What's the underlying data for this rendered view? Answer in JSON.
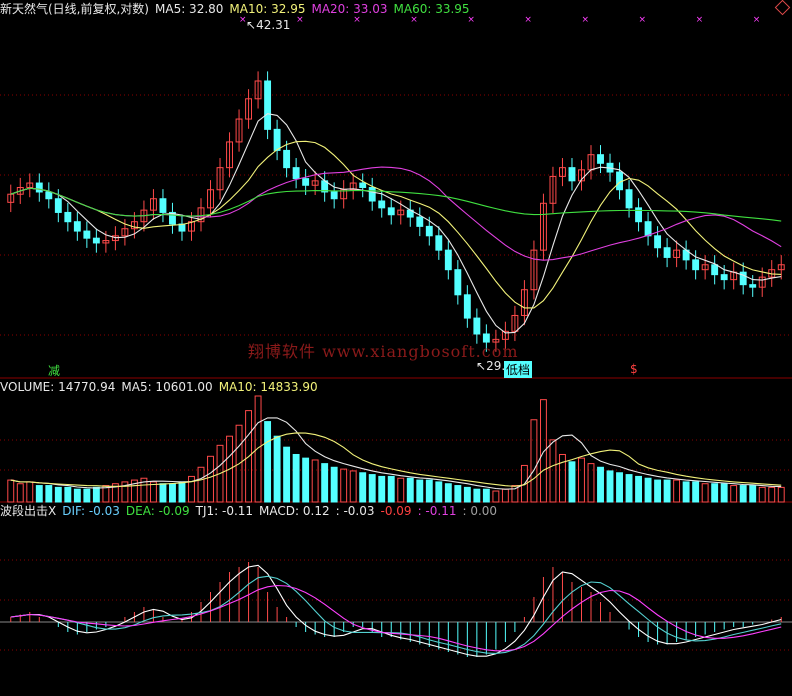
{
  "header": {
    "price": [
      {
        "text": "新天然气(日线,前复权,对数)",
        "color": "#e8e8e8"
      },
      {
        "text": "MA5: 32.80",
        "color": "#e8e8e8"
      },
      {
        "text": "MA10: 32.95",
        "color": "#f2f27a"
      },
      {
        "text": "MA20: 33.03",
        "color": "#e040e0"
      },
      {
        "text": "MA60: 33.95",
        "color": "#40e040"
      }
    ],
    "volume": [
      {
        "text": "VOLUME: 14770.94",
        "color": "#e8e8e8"
      },
      {
        "text": "MA5: 10601.00",
        "color": "#e8e8e8"
      },
      {
        "text": "MA10: 14833.90",
        "color": "#f2f27a"
      }
    ],
    "macd": [
      {
        "text": "波段出击X",
        "color": "#e8e8e8"
      },
      {
        "text": "DIF: -0.03",
        "color": "#6ad0ff"
      },
      {
        "text": "DEA: -0.09",
        "color": "#40e040"
      },
      {
        "text": "TJ1: -0.11",
        "color": "#e8e8e8"
      },
      {
        "text": "MACD: 0.12",
        "color": "#e8e8e8"
      },
      {
        "text": ": -0.03",
        "color": "#e8e8e8"
      },
      {
        "text": "-0.09",
        "color": "#ff4040"
      },
      {
        "text": ": -0.11",
        "color": "#e040e0"
      },
      {
        "text": ": 0.00",
        "color": "#a0a0a0"
      }
    ]
  },
  "annotations": {
    "high_label": "42.31",
    "low_label": "29.63",
    "jian_label": "减",
    "di_label": "低档",
    "dollar_label": "$",
    "watermark": "翔博软件 www.xiangbosoft.com"
  },
  "colors": {
    "up": "#ff4a4a",
    "down": "#54ffff",
    "ma5": "#e8e8e8",
    "ma10": "#f2f27a",
    "ma20": "#e040e0",
    "ma60": "#40e040",
    "grid": "#8b0000",
    "x_marker": "#ff40ff"
  },
  "icons": {
    "corner": "diamond-icon"
  },
  "chart_data": {
    "type": "candlestick",
    "scale": "log",
    "ylim": [
      29,
      44
    ],
    "high": 42.31,
    "low": 29.63,
    "closes": [
      35.8,
      36.1,
      36.3,
      35.9,
      35.6,
      35.0,
      34.6,
      34.2,
      33.9,
      33.7,
      33.8,
      34.0,
      34.3,
      34.6,
      35.1,
      35.6,
      35.0,
      34.5,
      34.2,
      34.6,
      35.2,
      36.0,
      37.0,
      38.2,
      39.3,
      40.3,
      41.2,
      38.8,
      37.8,
      37.0,
      36.5,
      36.2,
      36.4,
      35.9,
      35.6,
      36.0,
      36.3,
      36.1,
      35.5,
      35.2,
      34.9,
      35.1,
      34.8,
      34.4,
      34.0,
      33.4,
      32.6,
      31.6,
      30.7,
      30.1,
      29.8,
      29.9,
      30.2,
      30.8,
      31.8,
      33.4,
      35.4,
      36.6,
      37.0,
      36.4,
      36.9,
      37.6,
      37.2,
      36.8,
      36.0,
      35.2,
      34.6,
      34.0,
      33.5,
      33.1,
      33.4,
      33.0,
      32.6,
      32.8,
      32.4,
      32.2,
      32.5,
      32.0,
      31.9,
      32.3,
      32.6,
      32.8
    ],
    "volumes": [
      1.2,
      1.0,
      1.1,
      0.9,
      0.9,
      0.8,
      0.8,
      0.7,
      0.7,
      0.8,
      0.9,
      1.0,
      1.1,
      1.2,
      1.3,
      1.1,
      1.0,
      1.0,
      1.1,
      1.4,
      1.9,
      2.5,
      3.1,
      3.6,
      4.2,
      5.0,
      5.8,
      4.4,
      3.6,
      3.0,
      2.6,
      2.4,
      2.3,
      2.1,
      1.9,
      1.8,
      1.7,
      1.6,
      1.5,
      1.4,
      1.4,
      1.3,
      1.3,
      1.2,
      1.2,
      1.1,
      1.0,
      0.9,
      0.8,
      0.7,
      0.7,
      0.6,
      0.7,
      0.9,
      2.0,
      4.5,
      5.6,
      3.4,
      2.6,
      2.2,
      2.4,
      2.1,
      1.9,
      1.7,
      1.6,
      1.5,
      1.4,
      1.3,
      1.2,
      1.2,
      1.2,
      1.1,
      1.1,
      1.0,
      1.0,
      1.0,
      0.9,
      0.9,
      0.9,
      0.8,
      0.8,
      0.8
    ],
    "macd_hist": [
      0.1,
      0.15,
      0.2,
      0.1,
      0.0,
      -0.1,
      -0.2,
      -0.25,
      -0.2,
      -0.15,
      -0.1,
      0.0,
      0.1,
      0.2,
      0.3,
      0.25,
      0.1,
      0.0,
      0.05,
      0.2,
      0.4,
      0.6,
      0.8,
      1.0,
      1.1,
      1.2,
      1.1,
      0.6,
      0.3,
      0.1,
      -0.1,
      -0.2,
      -0.25,
      -0.3,
      -0.3,
      -0.2,
      -0.1,
      -0.1,
      -0.2,
      -0.3,
      -0.3,
      -0.35,
      -0.4,
      -0.45,
      -0.5,
      -0.55,
      -0.6,
      -0.65,
      -0.7,
      -0.7,
      -0.65,
      -0.55,
      -0.4,
      -0.2,
      0.1,
      0.5,
      0.9,
      1.1,
      1.0,
      0.8,
      0.7,
      0.6,
      0.4,
      0.2,
      0.0,
      -0.15,
      -0.3,
      -0.4,
      -0.45,
      -0.45,
      -0.4,
      -0.35,
      -0.3,
      -0.25,
      -0.2,
      -0.15,
      -0.1,
      -0.1,
      -0.05,
      0.0,
      0.05,
      0.1
    ]
  }
}
